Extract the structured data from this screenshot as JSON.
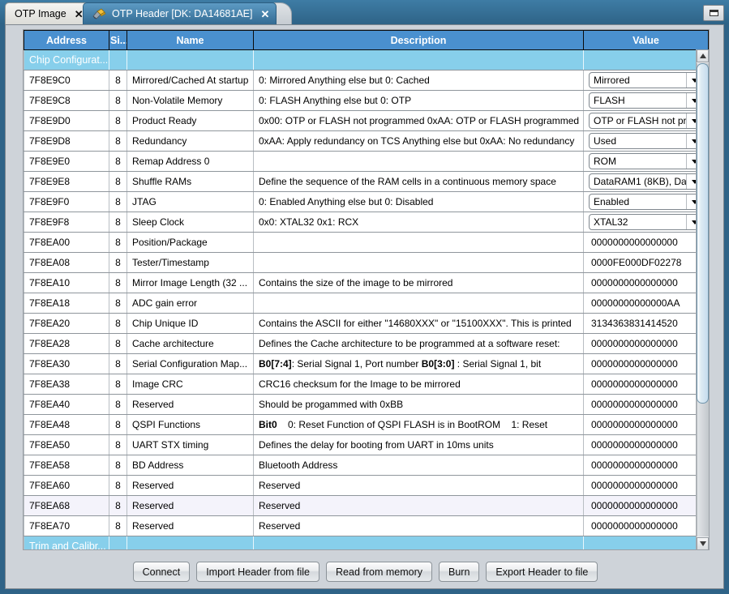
{
  "window": {
    "minimize_glyph": "restore-window"
  },
  "tabs": [
    {
      "label": "OTP Image",
      "active": false,
      "close": "✕",
      "icon": "none"
    },
    {
      "label": "OTP Header [DK: DA14681AE]",
      "active": true,
      "close": "✕",
      "icon": "burner-icon"
    }
  ],
  "table": {
    "columns": [
      "Address",
      "Si...",
      "Name",
      "Description",
      "Value"
    ],
    "group_top": "Chip Configurat...",
    "group_bottom": "Trim and Calibr...",
    "rows": [
      {
        "address": "7F8E9C0",
        "size": "8",
        "name": "Mirrored/Cached At startup",
        "desc": "0: Mirrored Anything else but 0: Cached",
        "desc_bold": "",
        "value": "Mirrored",
        "type": "combo",
        "selected": false
      },
      {
        "address": "7F8E9C8",
        "size": "8",
        "name": "Non-Volatile Memory",
        "desc": "0: FLASH Anything else but 0: OTP",
        "desc_bold": "",
        "value": "FLASH",
        "type": "combo",
        "selected": false
      },
      {
        "address": "7F8E9D0",
        "size": "8",
        "name": "Product Ready",
        "desc": "0x00: OTP or FLASH not programmed 0xAA: OTP or FLASH programmed",
        "desc_bold": "",
        "value": "OTP or FLASH not pr...",
        "type": "combo",
        "selected": false
      },
      {
        "address": "7F8E9D8",
        "size": "8",
        "name": "Redundancy",
        "desc": "0xAA: Apply redundancy on TCS Anything else but 0xAA: No redundancy",
        "desc_bold": "",
        "value": "Used",
        "type": "combo",
        "selected": false
      },
      {
        "address": "7F8E9E0",
        "size": "8",
        "name": "Remap Address 0",
        "desc": "",
        "desc_bold": "",
        "value": "ROM",
        "type": "combo",
        "selected": false
      },
      {
        "address": "7F8E9E8",
        "size": "8",
        "name": "Shuffle RAMs",
        "desc": "Define the sequence of the RAM cells in a continuous memory space",
        "desc_bold": "",
        "value": "DataRAM1 (8KB), Da...",
        "type": "combo",
        "selected": false
      },
      {
        "address": "7F8E9F0",
        "size": "8",
        "name": "JTAG",
        "desc": "0: Enabled Anything else but 0: Disabled",
        "desc_bold": "",
        "value": "Enabled",
        "type": "combo",
        "selected": false
      },
      {
        "address": "7F8E9F8",
        "size": "8",
        "name": "Sleep Clock",
        "desc": "0x0: XTAL32 0x1: RCX",
        "desc_bold": "",
        "value": "XTAL32",
        "type": "combo",
        "selected": false
      },
      {
        "address": "7F8EA00",
        "size": "8",
        "name": "Position/Package",
        "desc": "",
        "desc_bold": "",
        "value": "0000000000000000",
        "type": "text",
        "selected": false
      },
      {
        "address": "7F8EA08",
        "size": "8",
        "name": "Tester/Timestamp",
        "desc": "",
        "desc_bold": "",
        "value": "0000FE000DF02278",
        "type": "text",
        "selected": false
      },
      {
        "address": "7F8EA10",
        "size": "8",
        "name": "Mirror Image Length (32 ...",
        "desc": "Contains the size of the image to be mirrored",
        "desc_bold": "",
        "value": "0000000000000000",
        "type": "text",
        "selected": false
      },
      {
        "address": "7F8EA18",
        "size": "8",
        "name": "ADC gain error",
        "desc": "",
        "desc_bold": "",
        "value": "00000000000000AA",
        "type": "text",
        "selected": false
      },
      {
        "address": "7F8EA20",
        "size": "8",
        "name": "Chip Unique ID",
        "desc": "Contains the ASCII for either \"14680XXX\" or \"15100XXX\". This is printed",
        "desc_bold": "",
        "value": "3134363831414520",
        "type": "text",
        "selected": false
      },
      {
        "address": "7F8EA28",
        "size": "8",
        "name": "Cache architecture",
        "desc": "Defines the Cache architecture to be programmed at a software reset:",
        "desc_bold": "",
        "value": "0000000000000000",
        "type": "text",
        "selected": false
      },
      {
        "address": "7F8EA30",
        "size": "8",
        "name": "Serial Configuration Map...",
        "desc": "B0[7:4]|: Serial Signal 1, Port number |B0[3:0]| : Serial Signal 1, bit",
        "desc_bold": "markers",
        "value": "0000000000000000",
        "type": "text",
        "selected": false
      },
      {
        "address": "7F8EA38",
        "size": "8",
        "name": "Image CRC",
        "desc": "CRC16 checksum for the Image to be mirrored",
        "desc_bold": "",
        "value": "0000000000000000",
        "type": "text",
        "selected": false
      },
      {
        "address": "7F8EA40",
        "size": "8",
        "name": "Reserved",
        "desc": "Should be progammed with 0xBB",
        "desc_bold": "",
        "value": "0000000000000000",
        "type": "text",
        "selected": false
      },
      {
        "address": "7F8EA48",
        "size": "8",
        "name": "QSPI Functions",
        "desc": "Bit0|    0: Reset Function of QSPI FLASH is in BootROM    1: Reset",
        "desc_bold": "markers",
        "value": "0000000000000000",
        "type": "text",
        "selected": false
      },
      {
        "address": "7F8EA50",
        "size": "8",
        "name": "UART STX timing",
        "desc": "Defines the delay for booting from UART in 10ms units",
        "desc_bold": "",
        "value": "0000000000000000",
        "type": "text",
        "selected": false
      },
      {
        "address": "7F8EA58",
        "size": "8",
        "name": "BD Address",
        "desc": "Bluetooth Address",
        "desc_bold": "",
        "value": "0000000000000000",
        "type": "text",
        "selected": false
      },
      {
        "address": "7F8EA60",
        "size": "8",
        "name": "Reserved",
        "desc": "Reserved",
        "desc_bold": "",
        "value": "0000000000000000",
        "type": "text",
        "selected": false
      },
      {
        "address": "7F8EA68",
        "size": "8",
        "name": "Reserved",
        "desc": "Reserved",
        "desc_bold": "",
        "value": "0000000000000000",
        "type": "text",
        "selected": true
      },
      {
        "address": "7F8EA70",
        "size": "8",
        "name": "Reserved",
        "desc": "Reserved",
        "desc_bold": "",
        "value": "0000000000000000",
        "type": "text",
        "selected": false
      }
    ]
  },
  "scrollbar": {
    "up_arrow": "scroll-up-icon",
    "down_arrow": "scroll-down-icon"
  },
  "buttons": [
    {
      "label": "Connect"
    },
    {
      "label": "Import Header from file"
    },
    {
      "label": "Read from memory"
    },
    {
      "label": "Burn"
    },
    {
      "label": "Export Header to file"
    }
  ],
  "colors": {
    "header_blue": "#4a90cf",
    "group_blue": "#87cfeb",
    "window_blue": "#2f6387",
    "panel_gray": "#ced3d9",
    "selected_row": "#f4f3fb"
  }
}
